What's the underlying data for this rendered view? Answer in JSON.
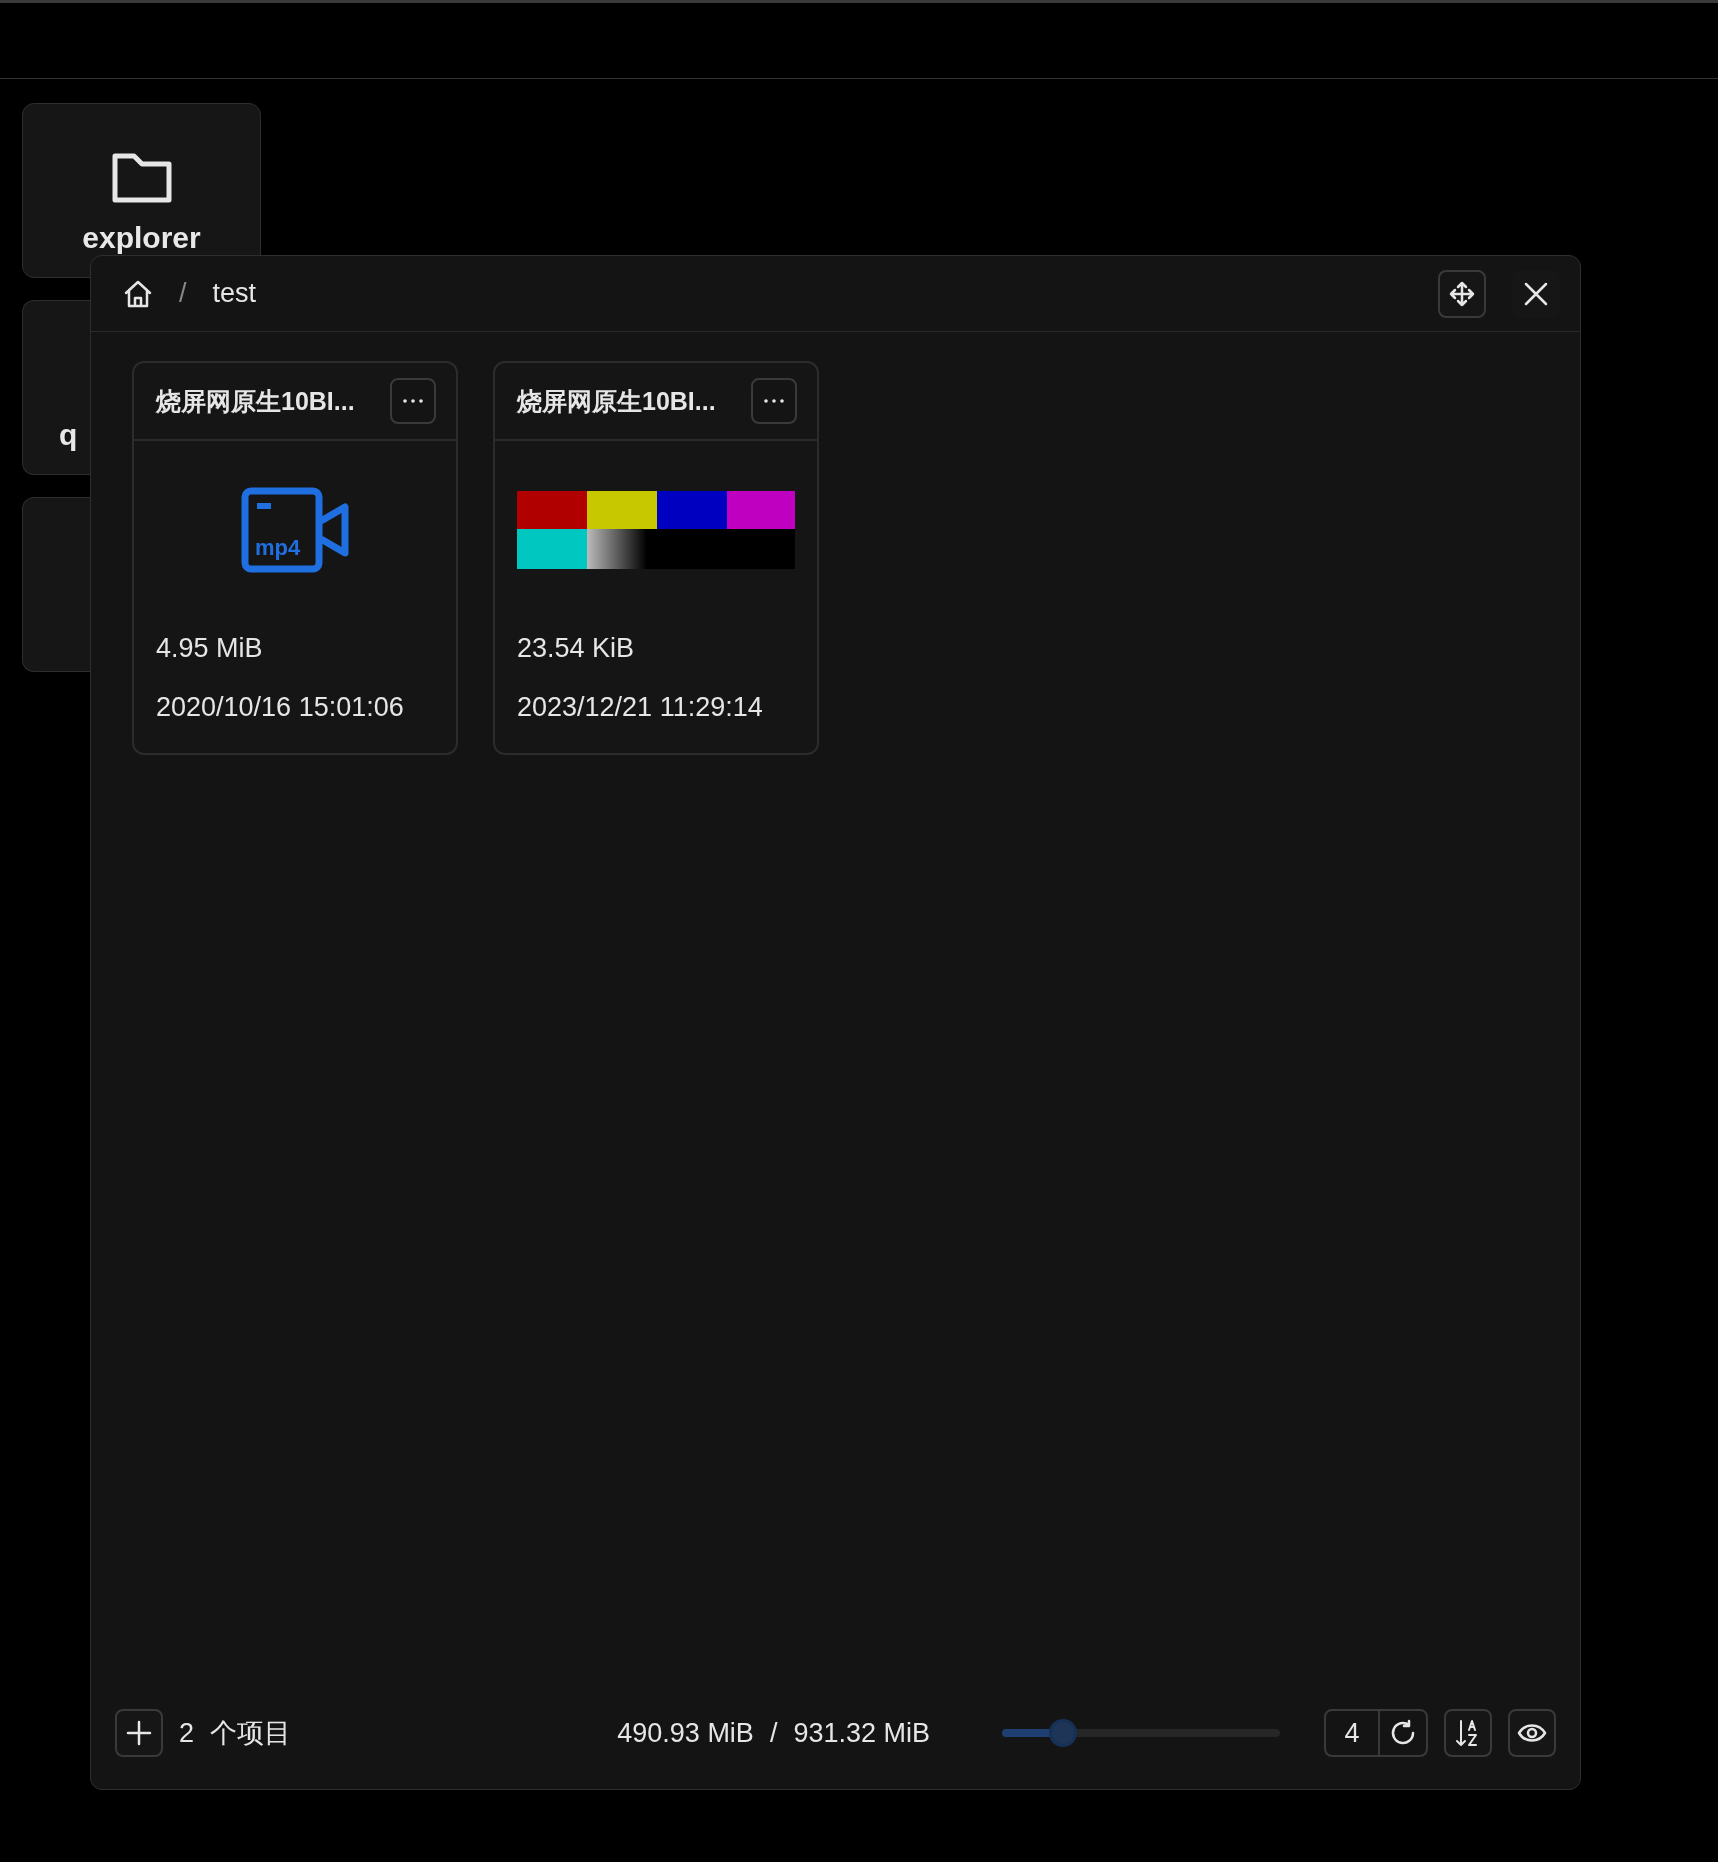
{
  "desktop_icons": [
    {
      "label": "explorer",
      "kind": "folder"
    },
    {
      "label": "q",
      "kind": "blank"
    },
    {
      "kind": "blank"
    }
  ],
  "window": {
    "breadcrumb": [
      {
        "kind": "home"
      },
      {
        "label": "test"
      }
    ],
    "breadcrumb_separator": "/",
    "files": [
      {
        "name": "烧屏网原生10BI...",
        "kind": "mp4",
        "size": "4.95 MiB",
        "modified": "2020/10/16 15:01:06"
      },
      {
        "name": "烧屏网原生10BI...",
        "kind": "picture",
        "size": "23.54 KiB",
        "modified": "2023/12/21 11:29:14"
      }
    ],
    "footer": {
      "count": "2",
      "count_label": "个项目",
      "used": "490.93 MiB",
      "separator": "/",
      "total": "931.32 MiB",
      "zoom": {
        "level": 0.22
      },
      "columns": "4"
    }
  }
}
